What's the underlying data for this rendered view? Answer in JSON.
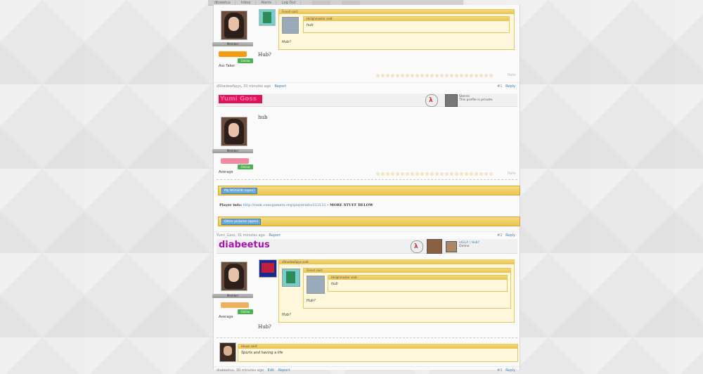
{
  "nav": {
    "items": [
      "dbseetus",
      "Inbox",
      "Alerts",
      "Log Out"
    ]
  },
  "post1": {
    "rank": "Member",
    "title": "Ass Taker",
    "online": "Online",
    "quote_outer_author": "Forest said:",
    "quote_inner_author": "Holighmaster said:",
    "quote_inner_text": "hub",
    "quote_outer_text": "Hub?",
    "message": "Hub?",
    "reactions_label": "Rate",
    "footer_meta": "dShadowSpys, 33 minutes ago",
    "report": "Report",
    "post_number": "#1",
    "reply": "Reply"
  },
  "post2": {
    "username": "Yumi Goss",
    "steam_name": "Skeres",
    "steam_status": "This profile is private.",
    "message": "hub",
    "rank": "Member",
    "title": "Average",
    "online": "Online",
    "reactions_label": "Rate",
    "sig_spoiler1": "My WOOZIK (open)",
    "sig_player_label": "Player info:",
    "sig_player_link": "http://rank.vanogamers.org/playerinfo/222151",
    "sig_player_more": "- MORE STUFF BELOW",
    "sig_spoiler2": "Other pictures (open)",
    "footer_meta": "Yumi_Gass, 31 minutes ago",
    "report": "Report",
    "post_number": "#2",
    "reply": "Reply"
  },
  "post3": {
    "username": "diabeetus",
    "steam_name": "elGLA | Hub?",
    "steam_status": "Online",
    "quote_outer_author": "dShadowSpys said:",
    "quote_mid_author": "Forest said:",
    "quote_inner_author": "Holighmaster said:",
    "quote_inner_text": "hub",
    "quote_mid_text": "Hub?",
    "message": "Hub?",
    "rank": "Member",
    "title": "Average",
    "online": "Online",
    "sig_quote_author": "House said:",
    "sig_quote_text": "Sports and having a life",
    "footer_meta": "diabeetus, 30 minutes ago",
    "edit": "Edit",
    "report": "Report",
    "post_number": "#3",
    "reply": "Reply"
  }
}
